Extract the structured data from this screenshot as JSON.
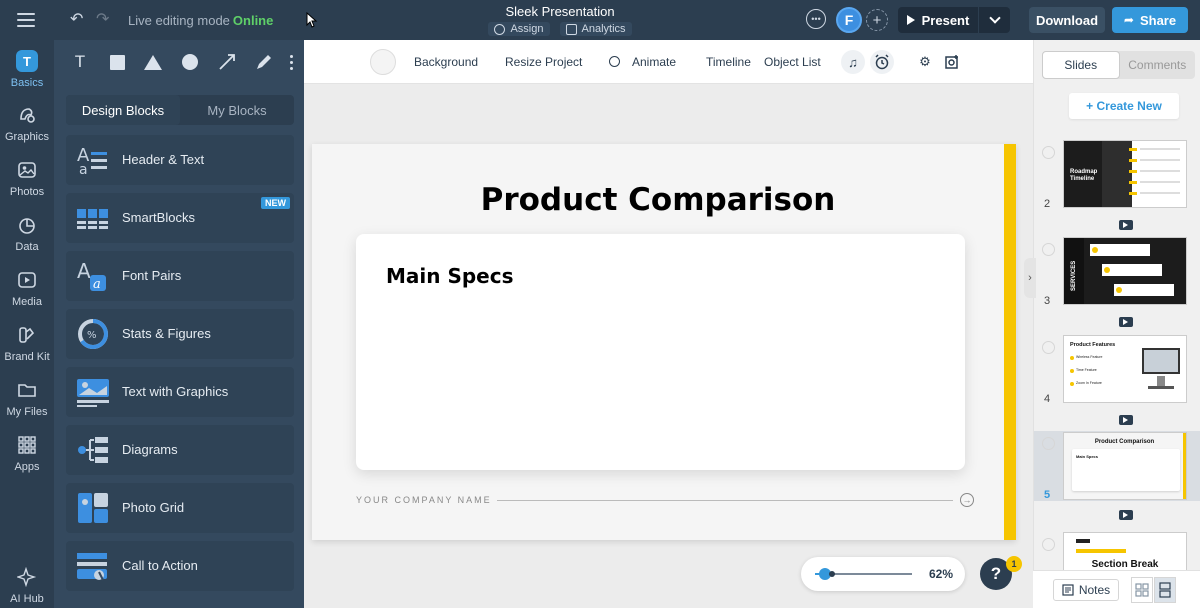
{
  "topbar": {
    "mode_label": "Live editing mode",
    "mode_status": "Online",
    "doc_title": "Sleek Presentation",
    "assign_label": "Assign",
    "analytics_label": "Analytics",
    "user_initial": "F",
    "present_label": "Present",
    "download_label": "Download",
    "share_label": "Share",
    "accent_color": "#3498db",
    "online_color": "#5fd068"
  },
  "leftnav": {
    "items": [
      {
        "label": "Basics",
        "icon": "basics-icon"
      },
      {
        "label": "Graphics",
        "icon": "graphics-icon"
      },
      {
        "label": "Photos",
        "icon": "photos-icon"
      },
      {
        "label": "Data",
        "icon": "pie-chart-icon"
      },
      {
        "label": "Media",
        "icon": "media-icon"
      },
      {
        "label": "Brand Kit",
        "icon": "brand-kit-icon"
      },
      {
        "label": "My Files",
        "icon": "folder-icon"
      },
      {
        "label": "Apps",
        "icon": "apps-grid-icon"
      },
      {
        "label": "AI Hub",
        "icon": "ai-sparkle-icon"
      }
    ],
    "basics_glyph": "T"
  },
  "panel": {
    "tools": [
      "text-tool-icon",
      "rectangle-tool-icon",
      "triangle-tool-icon",
      "circle-tool-icon",
      "line-tool-icon",
      "pen-tool-icon",
      "more-tools-icon"
    ],
    "text_tool_glyph": "T",
    "tabs": [
      "Design Blocks",
      "My Blocks"
    ],
    "blocks": [
      {
        "label": "Header & Text"
      },
      {
        "label": "SmartBlocks",
        "badge": "NEW"
      },
      {
        "label": "Font Pairs"
      },
      {
        "label": "Stats & Figures"
      },
      {
        "label": "Text with Graphics"
      },
      {
        "label": "Diagrams"
      },
      {
        "label": "Photo Grid"
      },
      {
        "label": "Call to Action"
      }
    ]
  },
  "editor_toolbar": {
    "background": "Background",
    "resize": "Resize Project",
    "animate": "Animate",
    "timeline": "Timeline",
    "object_list": "Object List"
  },
  "slide": {
    "title": "Product Comparison",
    "card_title": "Main Specs",
    "footer": "YOUR COMPANY NAME",
    "accent_color": "#f6c500"
  },
  "zoom": {
    "level": 62,
    "label": "62%"
  },
  "help": {
    "glyph": "?",
    "badge": "1"
  },
  "right_panel": {
    "tabs": [
      "Slides",
      "Comments"
    ],
    "create_new": "+ Create New",
    "thumbnails": [
      {
        "num": "2",
        "title": "Roadmap Timeline"
      },
      {
        "num": "3",
        "title": "SERVICES"
      },
      {
        "num": "4",
        "title": "Product Features",
        "items": [
          "Wireless Feature",
          "Time Feature",
          "Zoom In Feature"
        ]
      },
      {
        "num": "5",
        "title": "Product Comparison",
        "sub": "Main Specs",
        "active": true
      },
      {
        "num": "",
        "title": "Section Break"
      }
    ],
    "notes_label": "Notes"
  }
}
